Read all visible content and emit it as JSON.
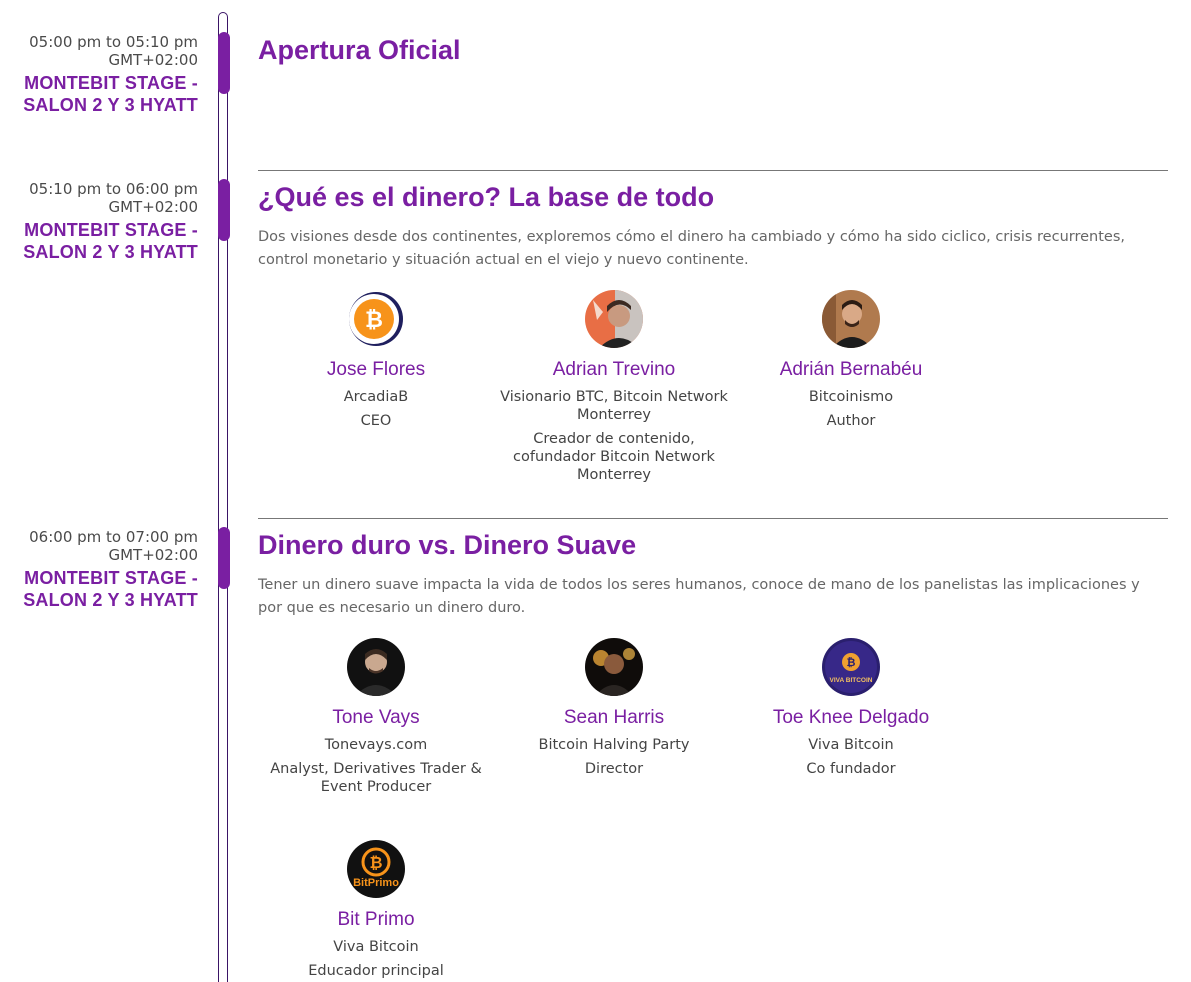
{
  "sessions": [
    {
      "time": "05:00 pm to 05:10 pm",
      "tz": "GMT+02:00",
      "stage": "MONTEBIT STAGE - SALON 2 Y 3 HYATT",
      "title": "Apertura Oficial",
      "description": "",
      "speakers": []
    },
    {
      "time": "05:10 pm to 06:00 pm",
      "tz": "GMT+02:00",
      "stage": "MONTEBIT STAGE - SALON 2 Y 3 HYATT",
      "title": "¿Qué es el dinero? La base de todo",
      "description": "Dos visiones desde dos continentes, exploremos cómo el dinero ha cambiado y cómo ha sido ciclico, crisis recurrentes, control monetario y situación actual en el viejo y nuevo continente.",
      "speakers": [
        {
          "name": "Jose Flores",
          "company": "ArcadiaB",
          "role": "CEO",
          "avatar": "bitcoin-logo-icon"
        },
        {
          "name": "Adrian Trevino",
          "company": "Visionario BTC, Bitcoin Network Monterrey",
          "role": "Creador de contenido, cofundador Bitcoin Network Monterrey",
          "avatar": "person-photo"
        },
        {
          "name": "Adrián Bernabéu",
          "company": "Bitcoinismo",
          "role": "Author",
          "avatar": "person-photo"
        }
      ]
    },
    {
      "time": "06:00 pm to 07:00 pm",
      "tz": "GMT+02:00",
      "stage": "MONTEBIT STAGE - SALON 2 Y 3 HYATT",
      "title": "Dinero duro vs. Dinero Suave",
      "description": "Tener un dinero suave impacta la vida de todos los seres humanos, conoce de mano de los panelistas las implicaciones y por que es necesario un dinero duro.",
      "speakers": [
        {
          "name": "Tone Vays",
          "company": "Tonevays.com",
          "role": "Analyst, Derivatives Trader & Event Producer",
          "avatar": "person-photo"
        },
        {
          "name": "Sean Harris",
          "company": "Bitcoin Halving Party",
          "role": "Director",
          "avatar": "person-photo"
        },
        {
          "name": "Toe Knee Delgado",
          "company": "Viva Bitcoin",
          "role": "Co fundador",
          "avatar": "viva-bitcoin-logo",
          "avatar_text": "VIVA BITCOIN"
        },
        {
          "name": "Bit Primo",
          "company": "Viva Bitcoin",
          "role": "Educador principal",
          "avatar": "bitprimo-logo",
          "avatar_text": "BitPrimo"
        }
      ]
    }
  ],
  "colors": {
    "accent": "#7a1fa2",
    "rail": "#3a1466",
    "text": "#444444",
    "muted": "#666666"
  }
}
